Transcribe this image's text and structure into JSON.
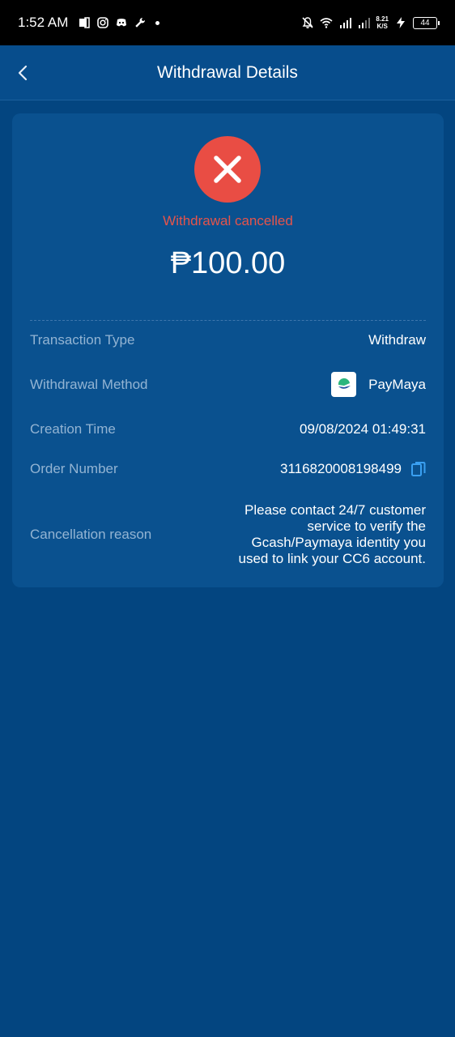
{
  "status_bar": {
    "time": "1:52 AM",
    "net_speed_value": "8.21",
    "net_speed_unit": "K/S",
    "battery": "44"
  },
  "header": {
    "title": "Withdrawal Details"
  },
  "summary": {
    "status": "Withdrawal cancelled",
    "amount": "₱100.00",
    "status_color": "#e94d44"
  },
  "details": {
    "transaction_type_label": "Transaction Type",
    "transaction_type_value": "Withdraw",
    "method_label": "Withdrawal Method",
    "method_value": "PayMaya",
    "creation_time_label": "Creation Time",
    "creation_time_value": "09/08/2024 01:49:31",
    "order_number_label": "Order Number",
    "order_number_value": "3116820008198499",
    "cancel_reason_label": "Cancellation reason",
    "cancel_reason_value": "Please contact 24/7 customer service to verify the Gcash/Paymaya identity you used to link your CC6 account."
  },
  "colors": {
    "background": "#034580",
    "card": "#0a518f",
    "accent": "#3aa0f2"
  }
}
